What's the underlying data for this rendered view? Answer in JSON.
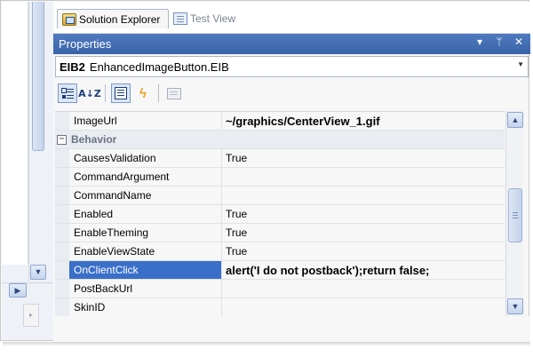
{
  "tabs": [
    {
      "label": "Solution Explorer",
      "icon": "solution-explorer-icon",
      "active": true
    },
    {
      "label": "Test View",
      "icon": "test-view-icon",
      "active": false
    }
  ],
  "properties": {
    "title": "Properties",
    "buttons": {
      "dropdown": "▾",
      "pin": "ᛘ",
      "close": "✕"
    }
  },
  "object_selector": {
    "name": "EIB2",
    "type": "EnhancedImageButton.EIB"
  },
  "toolbar": {
    "az_label": "A↓Z"
  },
  "grid": {
    "rows": [
      {
        "kind": "prop",
        "name": "ImageUrl",
        "value": "~/graphics/CenterView_1.gif",
        "bold": true
      },
      {
        "kind": "category",
        "name": "Behavior",
        "expander": "−"
      },
      {
        "kind": "prop",
        "name": "CausesValidation",
        "value": "True"
      },
      {
        "kind": "prop",
        "name": "CommandArgument",
        "value": ""
      },
      {
        "kind": "prop",
        "name": "CommandName",
        "value": ""
      },
      {
        "kind": "prop",
        "name": "Enabled",
        "value": "True"
      },
      {
        "kind": "prop",
        "name": "EnableTheming",
        "value": "True"
      },
      {
        "kind": "prop",
        "name": "EnableViewState",
        "value": "True"
      },
      {
        "kind": "prop",
        "name": "OnClientClick",
        "value": "alert('I do not postback');return false;",
        "bold": true,
        "selected": true
      },
      {
        "kind": "prop",
        "name": "PostBackUrl",
        "value": ""
      },
      {
        "kind": "prop",
        "name": "SkinID",
        "value": ""
      }
    ]
  },
  "colors": {
    "title_bar": "#3b64a8",
    "selection": "#3a6fc9",
    "category_bg": "#e9ecf1"
  }
}
